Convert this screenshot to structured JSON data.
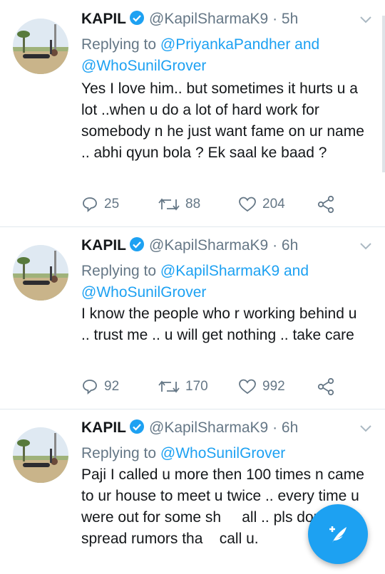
{
  "tweets": [
    {
      "name": "KAPIL",
      "handle": "@KapilSharmaK9 · 5h",
      "reply_prefix": "Replying to ",
      "reply_line1": "@PriyankaPandher and",
      "reply_line2": "@WhoSunilGrover",
      "text": "Yes I love him.. but sometimes it hurts u a lot ..when u do a lot of hard work for somebody n he just want fame on ur name .. abhi qyun bola ? Ek saal ke baad ?",
      "replies": "25",
      "retweets": "88",
      "likes": "204"
    },
    {
      "name": "KAPIL",
      "handle": "@KapilSharmaK9 · 6h",
      "reply_prefix": "Replying to ",
      "reply_line1": "@KapilSharmaK9 and",
      "reply_line2": "@WhoSunilGrover",
      "text": "I know the people who r working behind u .. trust me .. u will get nothing .. take care",
      "replies": "92",
      "retweets": "170",
      "likes": "992"
    },
    {
      "name": "KAPIL",
      "handle": "@KapilSharmaK9 · 6h",
      "reply_prefix": "Replying to ",
      "reply_line1": "@WhoSunilGrover",
      "text": "Paji I called u more then 100 times n came to ur house to meet u twice .. every time u were out for some sh     all .. pls don't spread rumors tha    call u."
    }
  ],
  "icons": {
    "verified": "verified-badge-icon",
    "reply": "reply-icon",
    "retweet": "retweet-icon",
    "like": "heart-icon",
    "share": "share-icon",
    "compose": "compose-tweet-icon",
    "menu": "chevron-down-icon"
  },
  "colors": {
    "accent": "#1da1f2",
    "muted": "#657786",
    "text": "#14171a"
  }
}
